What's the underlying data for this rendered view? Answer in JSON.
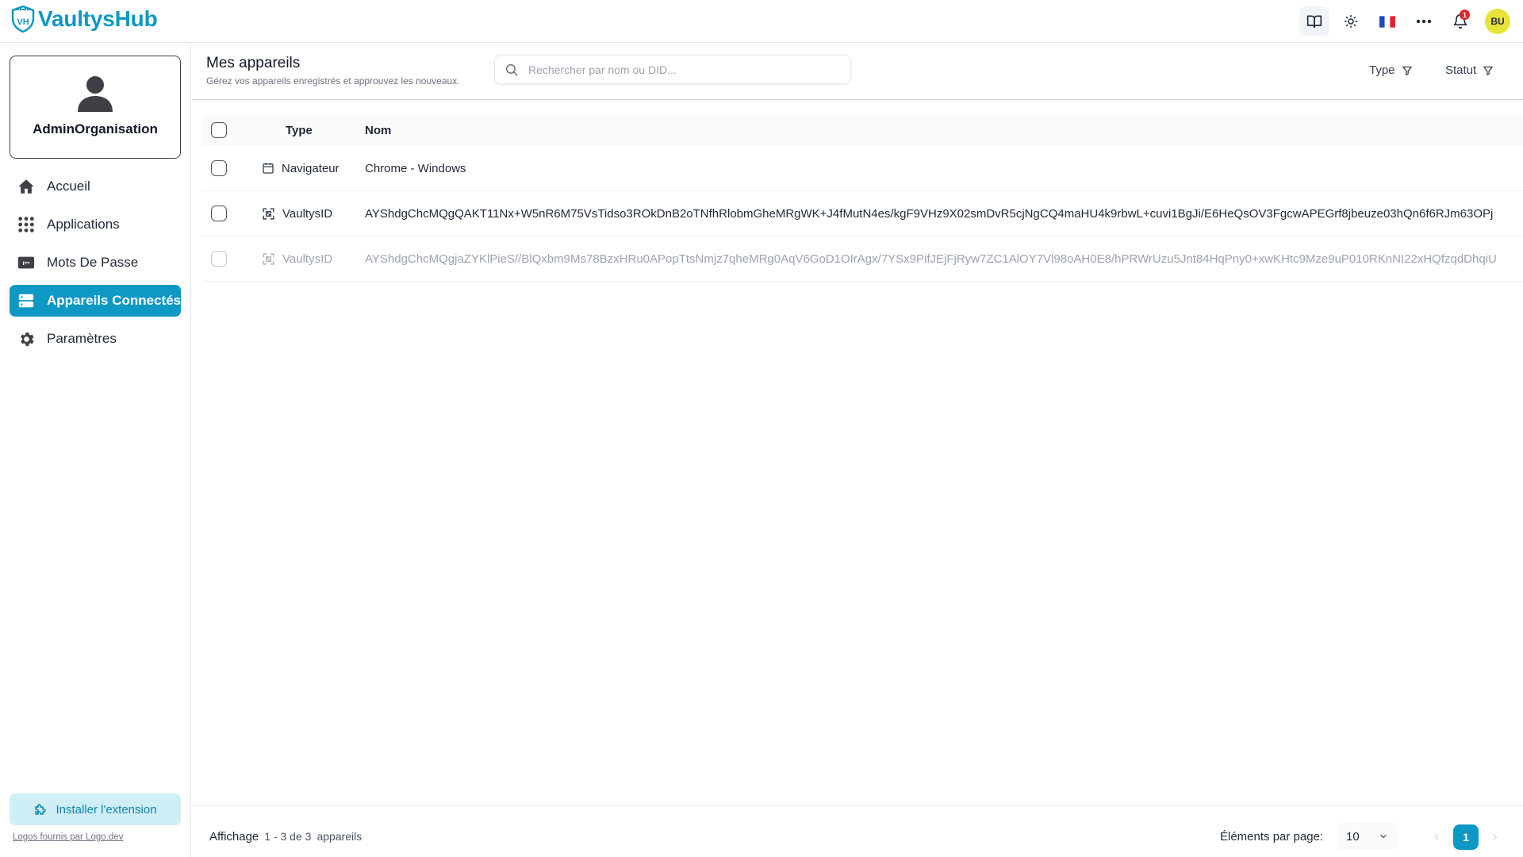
{
  "brand": {
    "name": "VaultysHub",
    "badge": "VH",
    "accent": "#0e98c4"
  },
  "topbar": {
    "icons": [
      "book-icon",
      "sun-icon",
      "french-flag-icon",
      "more-icon",
      "bell-icon"
    ],
    "notification_count": "1",
    "avatar_initials": "BU"
  },
  "sidebar": {
    "profile_name": "AdminOrganisation",
    "items": [
      {
        "label": "Accueil",
        "icon": "home-icon"
      },
      {
        "label": "Applications",
        "icon": "grid-icon"
      },
      {
        "label": "Mots De Passe",
        "icon": "password-icon"
      },
      {
        "label": "Appareils Connectés",
        "icon": "server-icon",
        "active": true
      },
      {
        "label": "Paramètres",
        "icon": "gear-icon"
      }
    ],
    "install_label": "Installer l'extension",
    "logos_credit": "Logos fournis par Logo.dev"
  },
  "page": {
    "title": "Mes appareils",
    "subtitle": "Gérez vos appareils enregistrés et approuvez les nouveaux.",
    "search_placeholder": "Rechercher par nom ou DID...",
    "filters": {
      "type": "Type",
      "status": "Statut"
    }
  },
  "table": {
    "headers": {
      "type": "Type",
      "name": "Nom"
    },
    "rows": [
      {
        "type": "Navigateur",
        "icon": "browser-icon",
        "name": "Chrome - Windows",
        "dim": false
      },
      {
        "type": "VaultysID",
        "icon": "qr-scan-icon",
        "name": "AYShdgChcMQgQAKT11Nx+W5nR6M75VsTidso3ROkDnB2oTNfhRlobmGheMRgWK+J4fMutN4es/kgF9VHz9X02smDvR5cjNgCQ4maHU4k9rbwL+cuvi1BgJi/E6HeQsOV3FgcwAPEGrf8jbeuze03hQn6f6RJm63OPj",
        "dim": false
      },
      {
        "type": "VaultysID",
        "icon": "qr-scan-icon",
        "name": "AYShdgChcMQgjaZYKlPieS//BlQxbm9Ms78BzxHRu0APopTtsNmjz7qheMRg0AqV6GoD1OIrAgx/7YSx9PifJEjFjRyw7ZC1AlOY7Vl98oAH0E8/hPRWrUzu5Jnt84HqPny0+xwKHtc9Mze9uP010RKnNI22xHQfzqdDhqiU",
        "dim": true
      }
    ]
  },
  "footer": {
    "display_label": "Affichage",
    "range": "1 - 3 de 3",
    "unit": "appareils",
    "per_page_label": "Éléments par page:",
    "per_page_value": "10",
    "current_page": "1"
  }
}
